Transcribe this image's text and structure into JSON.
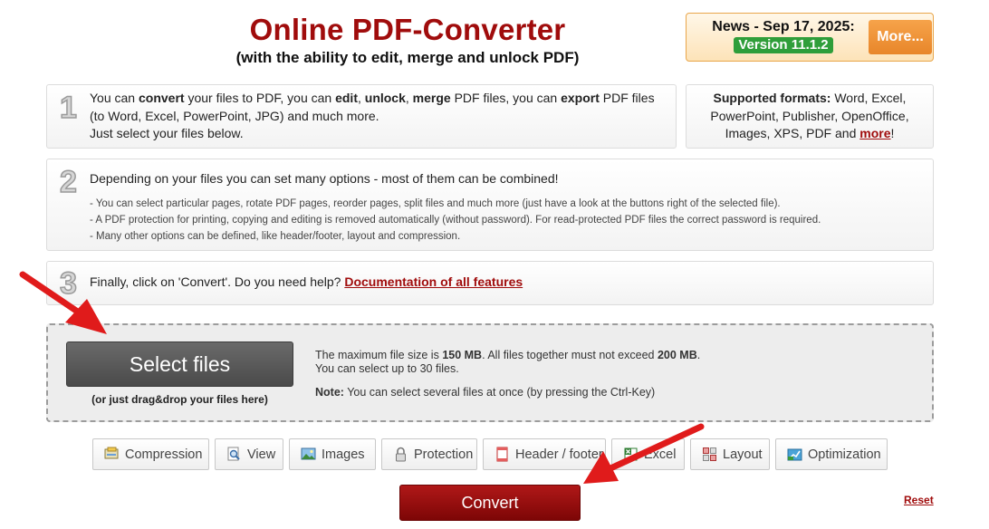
{
  "header": {
    "title": "Online PDF-Converter",
    "subtitle": "(with the ability to edit, merge and unlock PDF)"
  },
  "news": {
    "title": "News - Sep 17, 2025:",
    "version": "Version 11.1.2",
    "more_label": "More..."
  },
  "step1": {
    "number": "1",
    "t1": "You can ",
    "b1": "convert",
    "t2": " your files to PDF, you can ",
    "b2": "edit",
    "t3": ", ",
    "b3": "unlock",
    "t4": ", ",
    "b4": "merge",
    "t5": " PDF files, you can ",
    "b5": "export",
    "t6": " PDF files",
    "line2": "(to Word, Excel, PowerPoint, JPG) and much more.",
    "line3": "Just select your files below."
  },
  "formats": {
    "label": "Supported formats:",
    "text1": " Word, Excel,",
    "line2": "PowerPoint, Publisher, OpenOffice,",
    "line3": "Images, XPS, PDF and ",
    "more_link": "more",
    "end": "!"
  },
  "step2": {
    "number": "2",
    "heading": "Depending on your files you can set many options - most of them can be combined!",
    "bullets": [
      "- You can select particular pages, rotate PDF pages, reorder pages, split files and much more (just have a look at the buttons right of the selected file).",
      "- A PDF protection for printing, copying and editing is removed automatically (without password). For read-protected PDF files the correct password is required.",
      "- Many other options can be defined, like header/footer, layout and compression."
    ]
  },
  "step3": {
    "number": "3",
    "text": "Finally, click on 'Convert'. Do you need help? ",
    "link": "Documentation of all features"
  },
  "upload": {
    "select_label": "Select files",
    "drag_hint": "(or just drag&drop your files here)",
    "info1_a": "The maximum file size is ",
    "info1_b": "150 MB",
    "info1_c": ". All files together must not exceed ",
    "info1_d": "200 MB",
    "info1_e": ".",
    "info2": "You can select up to 30 files.",
    "note_label": "Note:",
    "note_text": " You can select several files at once (by pressing the Ctrl-Key)"
  },
  "options": [
    {
      "label": "Compression",
      "icon": "compression-icon"
    },
    {
      "label": "View",
      "icon": "magnifier-icon"
    },
    {
      "label": "Images",
      "icon": "image-icon"
    },
    {
      "label": "Protection",
      "icon": "lock-icon"
    },
    {
      "label": "Header / footer",
      "icon": "document-icon"
    },
    {
      "label": "Excel",
      "icon": "excel-icon"
    },
    {
      "label": "Layout",
      "icon": "layout-grid-icon"
    },
    {
      "label": "Optimization",
      "icon": "optimization-icon"
    }
  ],
  "actions": {
    "convert_label": "Convert",
    "reset_label": "Reset"
  },
  "colors": {
    "brand_red": "#a00c0c",
    "version_green": "#2f9e3a",
    "more_orange": "#e8862a",
    "arrow_red": "#e01b1b"
  }
}
